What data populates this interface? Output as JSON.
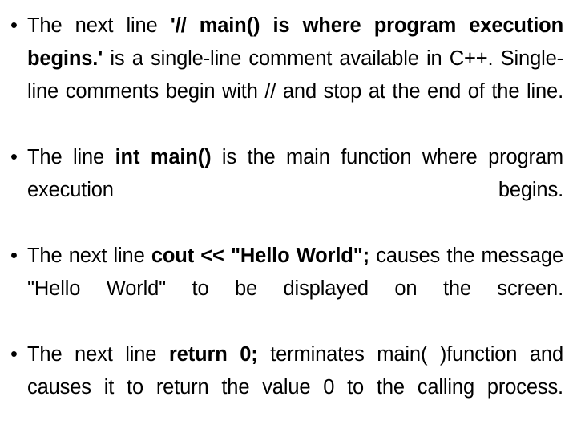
{
  "document": {
    "background_color": "#ffffff",
    "text_color": "#000000",
    "bullet_glyph": "•",
    "bullets": [
      {
        "id": "bullet-comment-line",
        "parts": [
          {
            "text": "The next line ",
            "bold": false
          },
          {
            "text": "'// main() is where program execution begins.'",
            "bold": true
          },
          {
            "text": " is a single-line comment available in C++. Single-line comments begin with // and stop at the end of the line.",
            "bold": false
          }
        ],
        "plain": "The next line '// main() is where program execution begins.' is a single-line comment available in C++. Single-line comments begin with // and stop at the end of the line."
      },
      {
        "id": "bullet-int-main",
        "parts": [
          {
            "text": "The line ",
            "bold": false
          },
          {
            "text": "int main()",
            "bold": true
          },
          {
            "text": " is the main function where program execution begins.",
            "bold": false
          }
        ],
        "plain": "The line int main() is the main function where program execution begins."
      },
      {
        "id": "bullet-cout-hello-world",
        "parts": [
          {
            "text": "The next line ",
            "bold": false
          },
          {
            "text": "cout << \"Hello World\";",
            "bold": true
          },
          {
            "text": " causes the message \"Hello World\" to be displayed on the screen.",
            "bold": false
          }
        ],
        "plain": "The next line cout << \"Hello World\"; causes the message \"Hello World\" to be displayed on the screen."
      },
      {
        "id": "bullet-return-zero",
        "parts": [
          {
            "text": "The next line ",
            "bold": false
          },
          {
            "text": "return 0;",
            "bold": true
          },
          {
            "text": " terminates main( )function and causes it to return the value 0 to the calling process.",
            "bold": false
          }
        ],
        "plain": "The next line return 0; terminates main( )function and causes it to return the value 0 to the calling process."
      }
    ]
  }
}
